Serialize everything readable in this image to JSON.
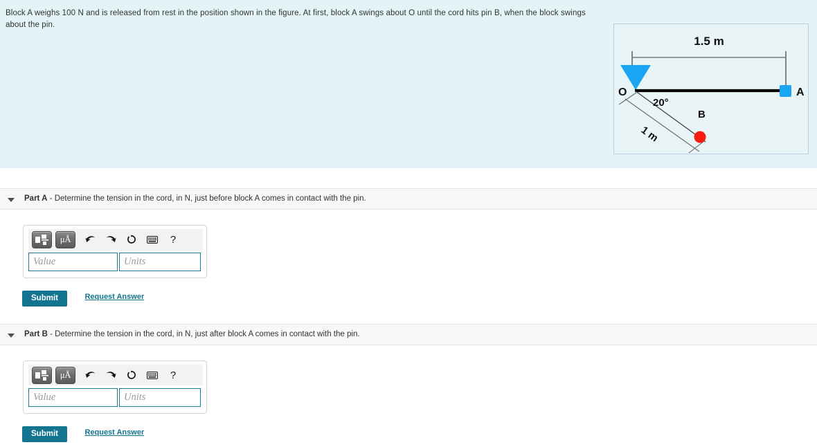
{
  "problem": {
    "statement": "Block A weighs 100 N and is released from rest in the position shown in the figure. At first, block A swings about O until the cord hits pin B, when the block swings about the pin."
  },
  "figure": {
    "top_dimension_label": "1.5 m",
    "cord_dimension_label": "1 m",
    "pivot_label": "O",
    "block_label": "A",
    "pin_label": "B",
    "angle_label": "20°",
    "colors": {
      "support_triangle": "#19a5f2",
      "block": "#19a5f2",
      "pin": "#f81c0f",
      "cord": "#000000",
      "dimension_line": "#555555",
      "panel_background": "#e8f4f6",
      "panel_border": "#b8cede"
    }
  },
  "parts": [
    {
      "id": "part-a",
      "title": "Part A",
      "separator": " - ",
      "question": "Determine the tension in the cord, in N, just before block A comes in contact with the pin.",
      "toolbar": {
        "template_icon": "math-template-icon",
        "units_label": "μÅ",
        "undo_icon": "undo-arrow-icon",
        "redo_icon": "redo-arrow-icon",
        "reset_icon": "reset-circular-arrow-icon",
        "keyboard_icon": "keyboard-icon",
        "help_label": "?"
      },
      "value_input": {
        "value": "",
        "placeholder": "Value"
      },
      "units_input": {
        "value": "",
        "placeholder": "Units"
      },
      "submit_label": "Submit",
      "request_answer_label": "Request Answer"
    },
    {
      "id": "part-b",
      "title": "Part B",
      "separator": " - ",
      "question": "Determine the tension in the cord, in N, just after block A comes in contact with the pin.",
      "toolbar": {
        "template_icon": "math-template-icon",
        "units_label": "μÅ",
        "undo_icon": "undo-arrow-icon",
        "redo_icon": "redo-arrow-icon",
        "reset_icon": "reset-circular-arrow-icon",
        "keyboard_icon": "keyboard-icon",
        "help_label": "?"
      },
      "value_input": {
        "value": "",
        "placeholder": "Value"
      },
      "units_input": {
        "value": "",
        "placeholder": "Units"
      },
      "submit_label": "Submit",
      "request_answer_label": "Request Answer"
    }
  ],
  "theme": {
    "problem_band_background": "#e4f3f5",
    "accent_teal": "#13748f",
    "part_bar_background": "#f8f8f8"
  }
}
